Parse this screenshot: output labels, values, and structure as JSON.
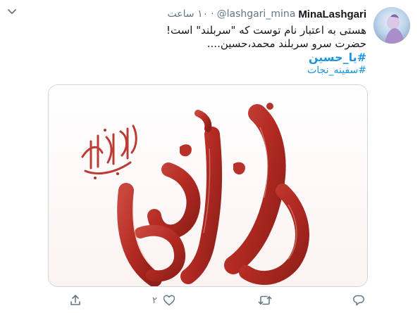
{
  "tweet": {
    "display_name": "MinaLashgari",
    "handle": "@lashgari_mina",
    "separator": "·",
    "timestamp": "۱۰ ساعت",
    "lines": [
      "هستی به اعتبار نام توست که \"سربلند\" است!",
      "حضرت سرو سربلند محمد،حسین...."
    ],
    "hashtags": [
      "#یا_حسین",
      "#سفینه_نجات"
    ]
  },
  "media": {
    "alt": "calligraphy-artwork",
    "colors": {
      "primary": "#b8312b",
      "dark": "#7d1a15",
      "light": "#e3b5ad"
    }
  },
  "actions": {
    "like_count": "۲"
  },
  "colors": {
    "accent": "#1b95e0",
    "text": "#14171a",
    "muted": "#657786",
    "border": "#ccd6dd"
  },
  "icons": [
    "caret-down-icon",
    "avatar",
    "comment-icon",
    "retweet-icon",
    "like-icon",
    "share-icon"
  ]
}
